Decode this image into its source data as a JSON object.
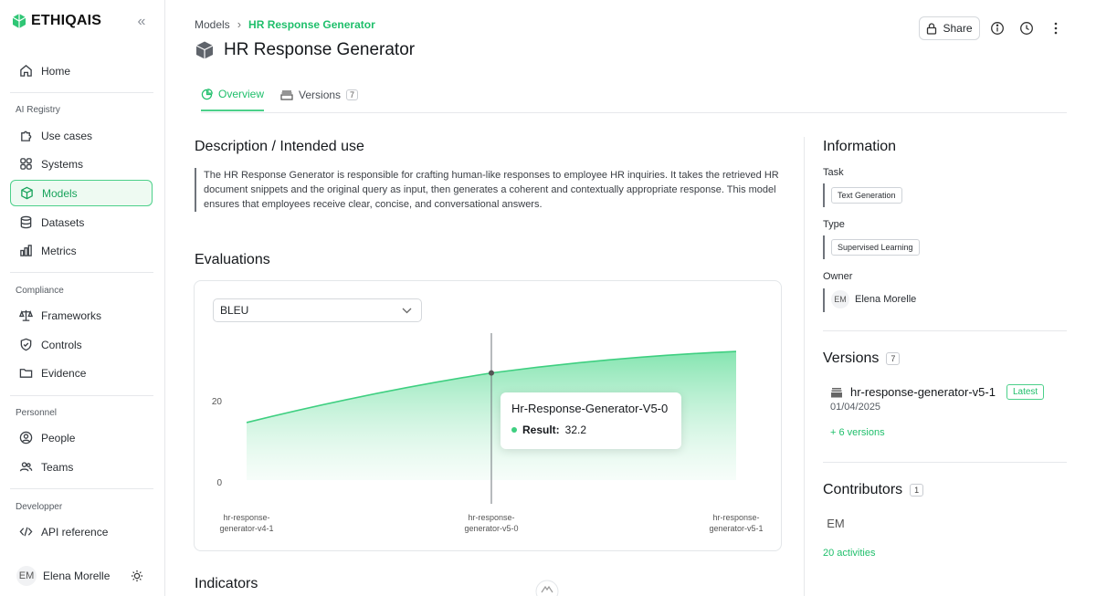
{
  "app": {
    "name": "ETHIQAIS"
  },
  "sidebar": {
    "top_items": [
      {
        "label": "Home",
        "icon": "home-icon"
      }
    ],
    "sections": [
      {
        "label": "AI Registry",
        "items": [
          {
            "label": "Use cases",
            "icon": "puzzle-icon"
          },
          {
            "label": "Systems",
            "icon": "grid-icon"
          },
          {
            "label": "Models",
            "icon": "cube-icon",
            "active": true
          },
          {
            "label": "Datasets",
            "icon": "database-icon"
          },
          {
            "label": "Metrics",
            "icon": "bar-chart-icon"
          }
        ]
      },
      {
        "label": "Compliance",
        "items": [
          {
            "label": "Frameworks",
            "icon": "scale-icon"
          },
          {
            "label": "Controls",
            "icon": "shield-icon"
          },
          {
            "label": "Evidence",
            "icon": "folder-icon"
          }
        ]
      },
      {
        "label": "Personnel",
        "items": [
          {
            "label": "People",
            "icon": "user-circle-icon"
          },
          {
            "label": "Teams",
            "icon": "users-icon"
          }
        ]
      },
      {
        "label": "Developper",
        "items": [
          {
            "label": "API reference",
            "icon": "code-icon"
          }
        ]
      }
    ],
    "user": {
      "initials": "EM",
      "name": "Elena Morelle"
    }
  },
  "header": {
    "breadcrumb": [
      "Models",
      "HR Response Generator"
    ],
    "title": "HR Response Generator",
    "share_label": "Share"
  },
  "tabs": [
    {
      "label": "Overview",
      "active": true
    },
    {
      "label": "Versions",
      "count": "7"
    }
  ],
  "description": {
    "heading": "Description / Intended use",
    "text": "The HR Response Generator is responsible for crafting human-like responses to employee HR inquiries. It takes the retrieved HR document snippets and the original query as input, then generates a coherent and contextually appropriate response. This model ensures that employees receive clear, concise, and conversational answers."
  },
  "evaluations": {
    "heading": "Evaluations",
    "selected_metric": "BLEU",
    "tooltip": {
      "title": "Hr-Response-Generator-V5-0",
      "key": "Result:",
      "value": "32.2"
    }
  },
  "chart_data": {
    "type": "area",
    "categories": [
      "hr-response-generator-v4-1",
      "hr-response-generator-v5-0",
      "hr-response-generator-v5-1"
    ],
    "tick_labels": [
      [
        "hr-response-",
        "generator-v4-1"
      ],
      [
        "hr-response-",
        "generator-v5-0"
      ],
      [
        "hr-response-",
        "generator-v5-1"
      ]
    ],
    "values": [
      20.0,
      32.2,
      37.5
    ],
    "yticks": [
      "0",
      "20"
    ],
    "ylim": [
      0,
      42
    ],
    "highlight_index": 1,
    "color": "#3ecf80"
  },
  "indicators": {
    "heading": "Indicators"
  },
  "information": {
    "heading": "Information",
    "task_label": "Task",
    "task": "Text Generation",
    "type_label": "Type",
    "type": "Supervised Learning",
    "owner_label": "Owner",
    "owner_initials": "EM",
    "owner_name": "Elena Morelle"
  },
  "versions": {
    "heading": "Versions",
    "count": "7",
    "latest_name": "hr-response-generator-v5-1",
    "latest_badge": "Latest",
    "latest_date": "01/04/2025",
    "more_link": "+ 6 versions"
  },
  "contributors": {
    "heading": "Contributors",
    "count": "1",
    "initials": "EM",
    "activities_link": "20 activities"
  },
  "colors": {
    "accent": "#1fbf6b",
    "accent_light": "#eefaf2"
  }
}
